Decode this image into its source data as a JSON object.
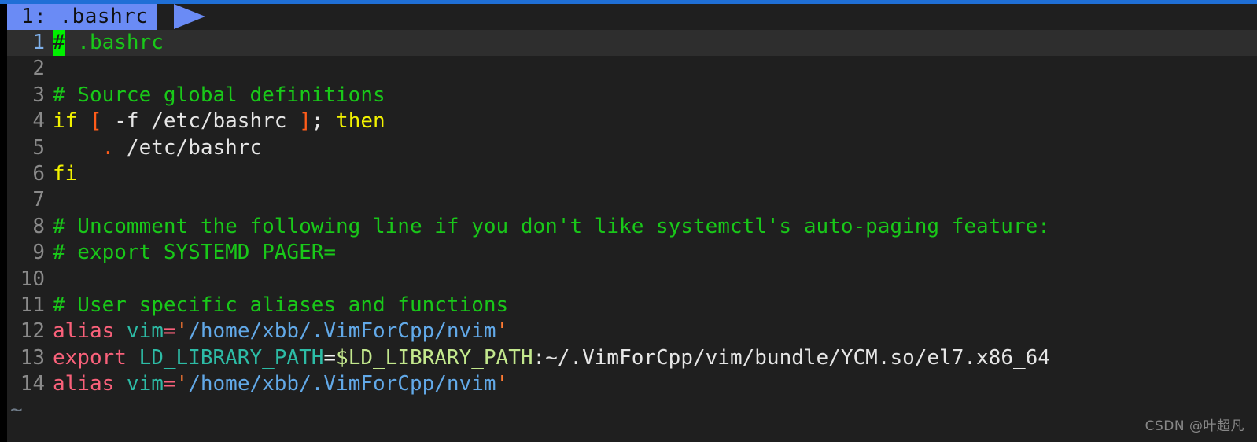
{
  "window": {
    "accent_color": "#1f6fd6",
    "background_color": "#1f1f1f"
  },
  "tabline": {
    "tabs": [
      {
        "label": "1: .bashrc",
        "active": true,
        "background_color": "#6a8bf5"
      }
    ]
  },
  "editor": {
    "filename": ".bashrc",
    "cursor": {
      "line": 1,
      "column": 1,
      "char": "#",
      "color": "#00f000"
    },
    "filler_char": "~",
    "lines": [
      {
        "num": "1",
        "cursorline": true,
        "tokens": [
          {
            "text": "#",
            "cls": "cursor-block"
          },
          {
            "text": " .bashrc",
            "cls": "t-comment"
          }
        ]
      },
      {
        "num": "2",
        "cursorline": false,
        "tokens": []
      },
      {
        "num": "3",
        "cursorline": false,
        "tokens": [
          {
            "text": "# Source global definitions",
            "cls": "t-comment"
          }
        ]
      },
      {
        "num": "4",
        "cursorline": false,
        "tokens": [
          {
            "text": "if ",
            "cls": "t-keyword"
          },
          {
            "text": "[",
            "cls": "t-bracket"
          },
          {
            "text": " -f /etc/bashrc ",
            "cls": "t-plain"
          },
          {
            "text": "]",
            "cls": "t-bracket"
          },
          {
            "text": "; ",
            "cls": "t-plain"
          },
          {
            "text": "then",
            "cls": "t-keyword"
          }
        ]
      },
      {
        "num": "5",
        "cursorline": false,
        "tokens": [
          {
            "text": "    ",
            "cls": "t-plain"
          },
          {
            "text": ".",
            "cls": "t-bracket"
          },
          {
            "text": " /etc/bashrc",
            "cls": "t-plain"
          }
        ]
      },
      {
        "num": "6",
        "cursorline": false,
        "tokens": [
          {
            "text": "fi",
            "cls": "t-keyword"
          }
        ]
      },
      {
        "num": "7",
        "cursorline": false,
        "tokens": []
      },
      {
        "num": "8",
        "cursorline": false,
        "tokens": [
          {
            "text": "# Uncomment the following line if you don't like systemctl's auto-paging feature:",
            "cls": "t-comment"
          }
        ]
      },
      {
        "num": "9",
        "cursorline": false,
        "tokens": [
          {
            "text": "# export SYSTEMD_PAGER=",
            "cls": "t-comment"
          }
        ]
      },
      {
        "num": "10",
        "cursorline": false,
        "tokens": []
      },
      {
        "num": "11",
        "cursorline": false,
        "tokens": [
          {
            "text": "# User specific aliases and functions",
            "cls": "t-comment"
          }
        ]
      },
      {
        "num": "12",
        "cursorline": false,
        "tokens": [
          {
            "text": "alias ",
            "cls": "t-alias"
          },
          {
            "text": "vim",
            "cls": "t-var"
          },
          {
            "text": "=",
            "cls": "t-eqpink"
          },
          {
            "text": "'",
            "cls": "t-quote"
          },
          {
            "text": "/home/xbb/.VimForCpp/nvim",
            "cls": "t-string"
          },
          {
            "text": "'",
            "cls": "t-quote"
          }
        ]
      },
      {
        "num": "13",
        "cursorline": false,
        "tokens": [
          {
            "text": "export ",
            "cls": "t-alias"
          },
          {
            "text": "LD_LIBRARY_PATH",
            "cls": "t-var"
          },
          {
            "text": "=",
            "cls": "t-eq"
          },
          {
            "text": "$LD_LIBRARY_PATH",
            "cls": "t-expand"
          },
          {
            "text": ":~/.VimForCpp/vim/bundle/YCM.so/el7.x86_64",
            "cls": "t-plain"
          }
        ]
      },
      {
        "num": "14",
        "cursorline": false,
        "tokens": [
          {
            "text": "alias ",
            "cls": "t-alias"
          },
          {
            "text": "vim",
            "cls": "t-var"
          },
          {
            "text": "=",
            "cls": "t-eqpink"
          },
          {
            "text": "'",
            "cls": "t-quote"
          },
          {
            "text": "/home/xbb/.VimForCpp/nvim",
            "cls": "t-string"
          },
          {
            "text": "'",
            "cls": "t-quote"
          }
        ]
      }
    ]
  },
  "watermark": {
    "text": "CSDN @叶超凡"
  }
}
